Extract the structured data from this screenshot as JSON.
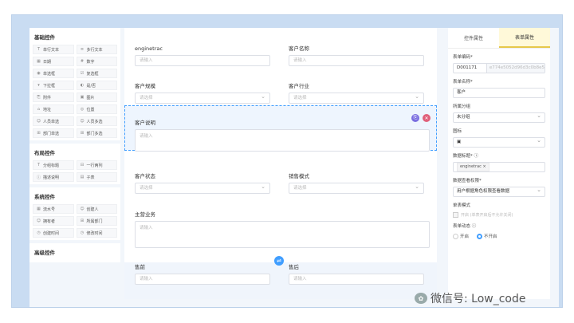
{
  "palette": {
    "groups": [
      {
        "title": "基础控件",
        "items": [
          {
            "icon": "T",
            "label": "单行文本"
          },
          {
            "icon": "≡",
            "label": "多行文本"
          },
          {
            "icon": "▦",
            "label": "日期"
          },
          {
            "icon": "#",
            "label": "数字"
          },
          {
            "icon": "◉",
            "label": "单选框"
          },
          {
            "icon": "☑",
            "label": "复选框"
          },
          {
            "icon": "▾",
            "label": "下拉框"
          },
          {
            "icon": "◐",
            "label": "是/否"
          },
          {
            "icon": "⎘",
            "label": "附件"
          },
          {
            "icon": "▣",
            "label": "图片"
          },
          {
            "icon": "⌂",
            "label": "地址"
          },
          {
            "icon": "◎",
            "label": "位置"
          },
          {
            "icon": "☺",
            "label": "人员单选"
          },
          {
            "icon": "☺",
            "label": "人员多选"
          },
          {
            "icon": "⊞",
            "label": "部门单选"
          },
          {
            "icon": "⊞",
            "label": "部门多选"
          }
        ]
      },
      {
        "title": "布局控件",
        "items": [
          {
            "icon": "T",
            "label": "分组标题"
          },
          {
            "icon": "⊟",
            "label": "一行两列"
          },
          {
            "icon": "ⓘ",
            "label": "描述说明"
          },
          {
            "icon": "▤",
            "label": "子表"
          }
        ]
      },
      {
        "title": "系统控件",
        "items": [
          {
            "icon": "▦",
            "label": "流水号"
          },
          {
            "icon": "☺",
            "label": "创建人"
          },
          {
            "icon": "☺",
            "label": "拥有者"
          },
          {
            "icon": "⊞",
            "label": "所属部门"
          },
          {
            "icon": "◷",
            "label": "创建时间"
          },
          {
            "icon": "◷",
            "label": "修改时间"
          }
        ]
      },
      {
        "title": "高级控件",
        "items": []
      }
    ]
  },
  "canvas": {
    "fields": {
      "enginetrac": {
        "label": "enginetrac",
        "placeholder": "请输入"
      },
      "customer_name": {
        "label": "客户名称",
        "placeholder": "请输入"
      },
      "customer_scale": {
        "label": "客户规模",
        "placeholder": "请选择"
      },
      "customer_industry": {
        "label": "客户行业",
        "placeholder": "请选择"
      },
      "customer_desc": {
        "label": "客户说明",
        "placeholder": "请输入"
      },
      "customer_status": {
        "label": "客户状态",
        "placeholder": "请选择"
      },
      "sales_mode": {
        "label": "销售模式",
        "placeholder": "请选择"
      },
      "main_business": {
        "label": "主营业务",
        "placeholder": "请输入"
      },
      "presale": {
        "label": "售前",
        "placeholder": "请输入"
      },
      "aftersale": {
        "label": "售后",
        "placeholder": "请输入"
      }
    }
  },
  "props": {
    "tabs": [
      "控件属性",
      "表单属性"
    ],
    "form_code_label": "表单编码*",
    "form_code_prefix": "D001171",
    "form_code_value": "e774e5052d96d3c0b8e5",
    "form_name_label": "表单名称*",
    "form_name_value": "客户",
    "category_label": "所属分组",
    "category_value": "未分组",
    "icon_label": "图标",
    "data_title_label": "数据标题* ⓘ",
    "data_title_tag": "enginetrac ×",
    "permission_label": "数据查看权限*",
    "permission_value": "用户根据角色权限查看数据",
    "mode_label": "单表模式",
    "mode_check": "开启  (单表开启后不允许关闭)",
    "dynamic_label": "表单动态 ⓘ",
    "radio_on": "开启",
    "radio_off": "不开启"
  },
  "watermark": "微信号: Low_code"
}
